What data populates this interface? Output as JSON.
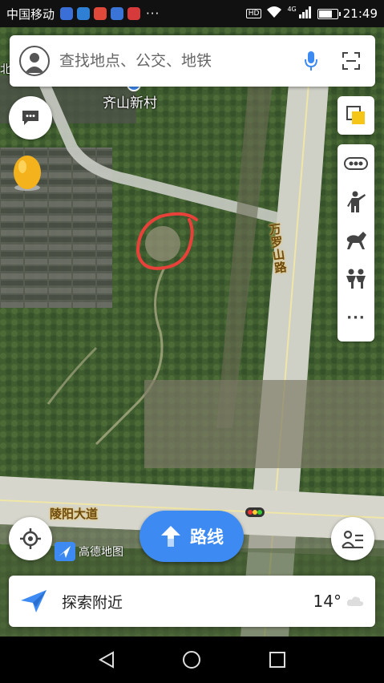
{
  "status_bar": {
    "carrier": "中国移动",
    "more": "···",
    "hd": "HD",
    "network": "4G",
    "time": "21:49",
    "battery_level": 0.75
  },
  "search": {
    "placeholder": "查找地点、公交、地铁"
  },
  "map": {
    "poi_label": "齐山新村",
    "roads": {
      "vertical": "万罗山路",
      "horizontal": "陵阳大道"
    },
    "partial_label": "北"
  },
  "route_button": {
    "label": "路线"
  },
  "logo": {
    "text": "高德地图"
  },
  "explore": {
    "label": "探索附近",
    "temperature": "14°"
  },
  "colors": {
    "accent": "#3d8bf2",
    "road_label": "#6b4a14",
    "mark": "#e8413a"
  }
}
